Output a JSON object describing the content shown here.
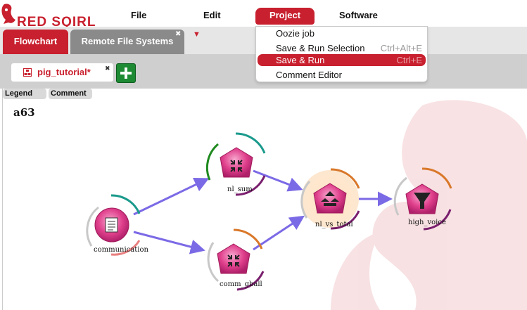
{
  "app": {
    "logo_text": "RED SQIRL"
  },
  "menubar": {
    "file": "File",
    "edit": "Edit",
    "project": "Project",
    "software": "Software"
  },
  "tabs": [
    {
      "label": "Flowchart",
      "active": true
    },
    {
      "label": "Remote File Systems",
      "active": false
    }
  ],
  "subtab": {
    "label": "pig_tutorial*"
  },
  "toolbar": {
    "legend": "Legend",
    "comment": "Comment"
  },
  "canvas": {
    "title": "a63"
  },
  "project_menu": {
    "items": [
      {
        "label": "Oozie job",
        "shortcut": ""
      },
      {
        "label": "Save & Run Selection",
        "shortcut": "Ctrl+Alt+E"
      },
      {
        "label": "Save & Run",
        "shortcut": "Ctrl+E",
        "highlighted": true
      },
      {
        "label": "Comment Editor",
        "shortcut": ""
      }
    ]
  },
  "nodes": [
    {
      "id": "communication",
      "label": "communication",
      "icon": "document-icon"
    },
    {
      "id": "nl_sum",
      "label": "nl_sum",
      "icon": "compress-arrows-icon"
    },
    {
      "id": "comm_gball",
      "label": "comm_gball",
      "icon": "compress-arrows-icon"
    },
    {
      "id": "nl_vs_total",
      "label": "nl_vs_total",
      "icon": "join-icon",
      "selected": true
    },
    {
      "id": "high_voice",
      "label": "high_voice",
      "icon": "filter-funnel-icon"
    }
  ],
  "colors": {
    "brand_red": "#c8202e",
    "arrow": "#7b6ae6",
    "node_pink": "#e0408c",
    "add_green": "#1e8a34",
    "status_teal": "#1a9a8c",
    "status_orange": "#d9782a",
    "status_green": "#1f8a1f",
    "status_purple": "#7a1f6e",
    "status_grey": "#c8c8c8"
  }
}
